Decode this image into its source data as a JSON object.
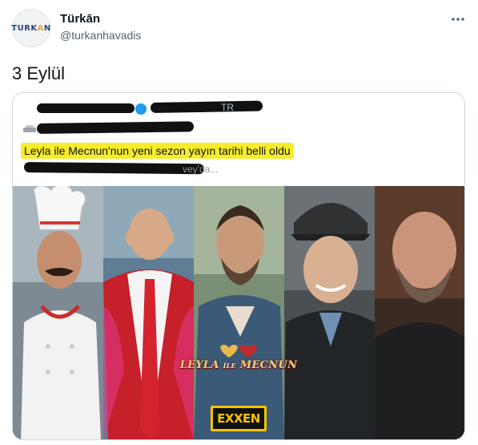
{
  "author": {
    "name": "Türkān",
    "handle": "@turkanhavadis",
    "avatar_logo_prefix": "TURK",
    "avatar_logo_accent": "A",
    "avatar_logo_suffix": "N",
    "avatar_icon": "turkan-logo"
  },
  "tweet": {
    "text": "3 Eylül",
    "more_icon": "ellipsis-icon"
  },
  "quoted": {
    "headline": "Leyla ile Mecnun'nun yeni sezon yayın tarihi belli oldu",
    "faint_handle": "TR",
    "faint_subtitle": "vey'da...",
    "highlight_color": "#f7ec2b",
    "verified_color": "#1d9bf0"
  },
  "media": {
    "logo_title_a": "LEYLA",
    "logo_title_ile": "İLE",
    "logo_title_b": "MECNUN",
    "brand_badge": "EXXEN",
    "brand_color": "#f5c400"
  }
}
